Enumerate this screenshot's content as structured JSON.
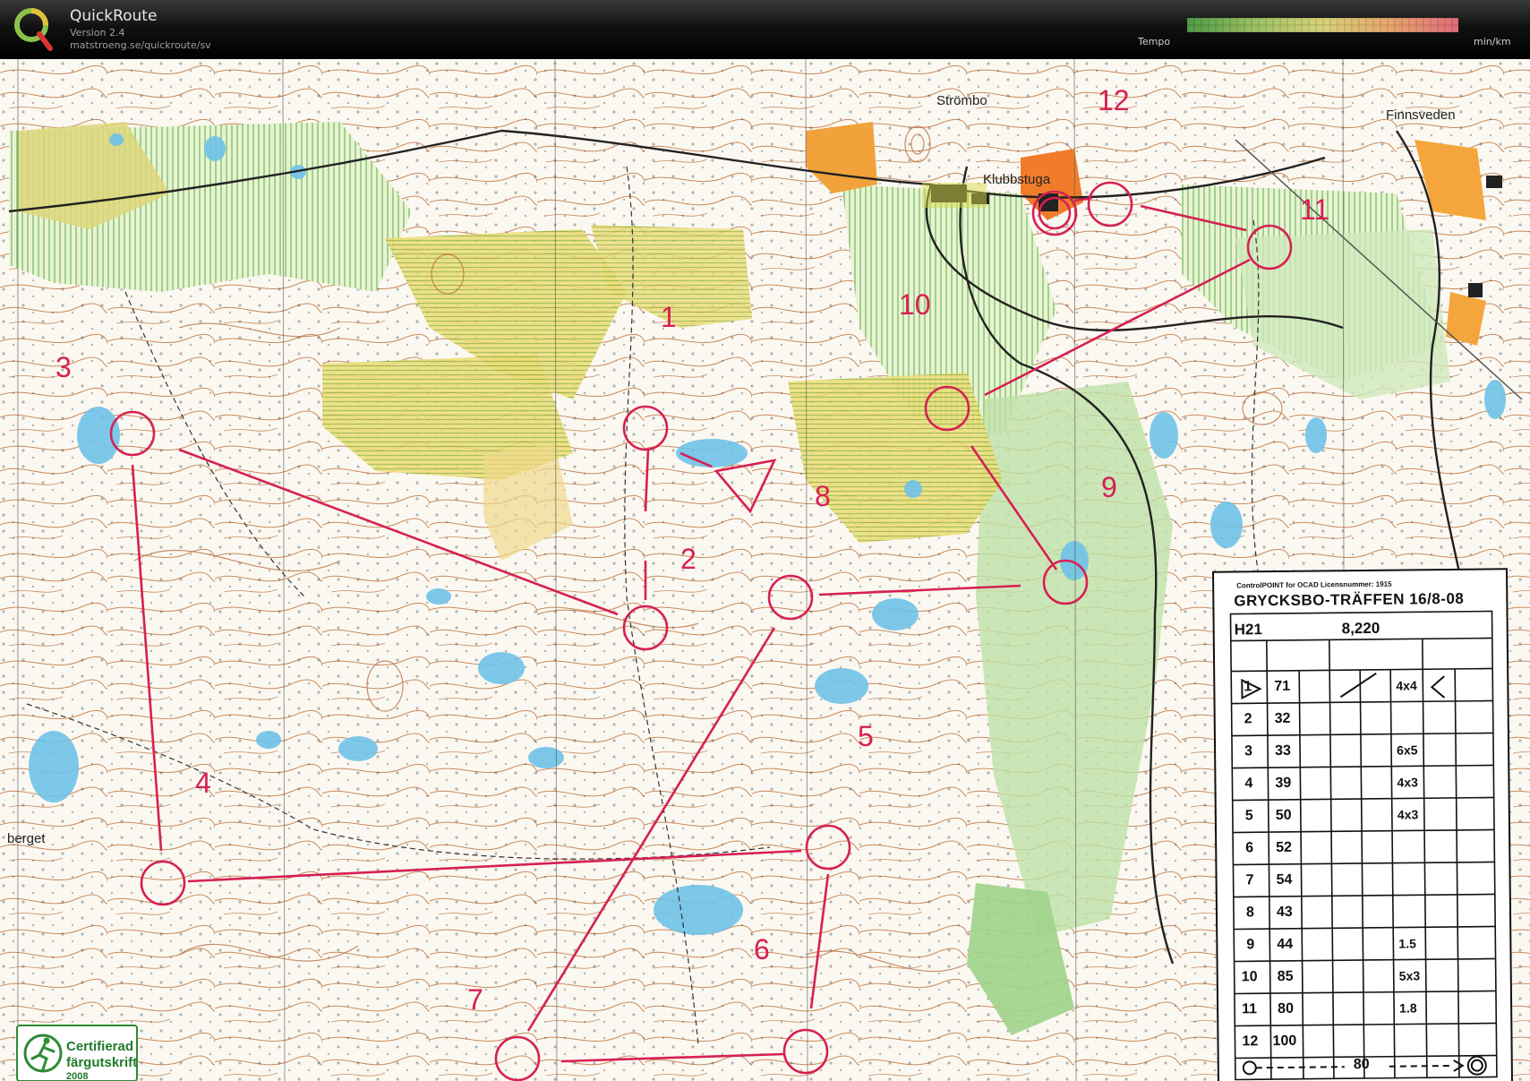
{
  "app": {
    "title": "QuickRoute",
    "version": "Version 2.4",
    "url": "matstroeng.se/quickroute/sv",
    "tempo_label": "Tempo",
    "tempo_unit": "min/km"
  },
  "colors": {
    "course": "#d62054",
    "tempo_gradient": [
      "#4f9a48",
      "#9cc063",
      "#d8d27a",
      "#e7a56c",
      "#e06b7a"
    ]
  },
  "map": {
    "places": [
      "Strömbo",
      "Klubbstuga",
      "Finnsveden",
      "berget"
    ],
    "controls": [
      {
        "label": "1"
      },
      {
        "label": "2"
      },
      {
        "label": "3"
      },
      {
        "label": "4"
      },
      {
        "label": "5"
      },
      {
        "label": "6"
      },
      {
        "label": "7"
      },
      {
        "label": "8"
      },
      {
        "label": "9"
      },
      {
        "label": "10"
      },
      {
        "label": "11"
      },
      {
        "label": "12"
      }
    ]
  },
  "description": {
    "header_small": "ControlPOINT for OCAD Licensnummer: 1915",
    "title": "GRYCKSBO-TRÄFFEN 16/8-08",
    "class": "H21",
    "length": "8,220",
    "rows": [
      {
        "num": "1",
        "code": "71",
        "dim": "4x4"
      },
      {
        "num": "2",
        "code": "32",
        "dim": ""
      },
      {
        "num": "3",
        "code": "33",
        "dim": "6x5"
      },
      {
        "num": "4",
        "code": "39",
        "dim": "4x3"
      },
      {
        "num": "5",
        "code": "50",
        "dim": "4x3"
      },
      {
        "num": "6",
        "code": "52",
        "dim": ""
      },
      {
        "num": "7",
        "code": "54",
        "dim": ""
      },
      {
        "num": "8",
        "code": "43",
        "dim": ""
      },
      {
        "num": "9",
        "code": "44",
        "dim": "1.5"
      },
      {
        "num": "10",
        "code": "85",
        "dim": "5x3"
      },
      {
        "num": "11",
        "code": "80",
        "dim": "1.8"
      },
      {
        "num": "12",
        "code": "100",
        "dim": ""
      }
    ],
    "finish_distance": "80"
  },
  "certificate": {
    "line1": "Certifierad",
    "line2": "färgutskrift",
    "line3": "2008"
  }
}
